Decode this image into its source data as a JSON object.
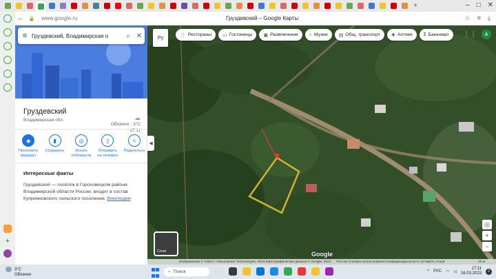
{
  "browser": {
    "url": "www.google.ru",
    "page_title": "Груздевский – Google Карты"
  },
  "search": {
    "query": "Груздевский, Владимирская о"
  },
  "place": {
    "name": "Груздевский",
    "region": "Владимирская обл.",
    "weather_line1": "Облачно · 3°C",
    "weather_line2": "17:11"
  },
  "actions": [
    {
      "label": "Проложить маршрут"
    },
    {
      "label": "Сохранить"
    },
    {
      "label": "Искать поблизости"
    },
    {
      "label": "Отправить на телефон"
    },
    {
      "label": "Поделиться"
    }
  ],
  "facts": {
    "heading": "Интересные факты",
    "text": "Груздевский — посёлок в Гороховецком районе Владимирской области России, входит в состав Куприяновского сельского поселения.",
    "link": "Википедия"
  },
  "map": {
    "layer_toggle": "Ру",
    "chips": [
      {
        "label": "Рестораны",
        "icon": "fork-knife-icon"
      },
      {
        "label": "Гостиницы",
        "icon": "bed-icon"
      },
      {
        "label": "Развлечения",
        "icon": "ticket-icon"
      },
      {
        "label": "Музеи",
        "icon": "museum-icon"
      },
      {
        "label": "Общ. транспорт",
        "icon": "bus-icon"
      },
      {
        "label": "Аптеки",
        "icon": "pill-icon"
      },
      {
        "label": "Банкомат",
        "icon": "atm-icon"
      }
    ],
    "account_initial": "A",
    "layers_label": "Слои",
    "logo": "Google",
    "attribution": "Изображения © CNES / Airbus,Maxar Technologies, 2023,Картографические данные © Google, 2023",
    "attribution_links": "Россия   Условия использования   Конфиденциальность   Оставить отзыв",
    "scale": "20 м",
    "colors": {
      "plot_outline": "#d4b42a",
      "pin": "#e53935"
    }
  },
  "taskbar": {
    "temp": "3°C",
    "condition": "Облачно",
    "search_placeholder": "Поиск",
    "lang": "РУС",
    "time": "17:11",
    "date": "16.03.2023",
    "notif_count": "2"
  }
}
